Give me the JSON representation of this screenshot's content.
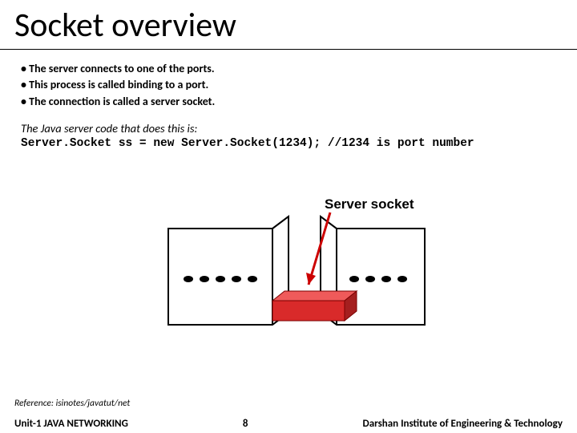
{
  "title": "Socket overview",
  "bullets": [
    {
      "pre": "• The server connects to one of the ports.",
      "bold": "",
      "post": ""
    },
    {
      "pre": "• This process is called ",
      "bold": "binding",
      "post": " to a port."
    },
    {
      "pre": "• The connection is called a server socket.",
      "bold": "",
      "post": ""
    }
  ],
  "intro": "The Java server code that does this is:",
  "code": "Server.Socket ss = new Server.Socket(1234); //1234 is port number",
  "figure_label": "Server socket",
  "reference": "Reference: isinotes/javatut/net",
  "footer": {
    "unit": "Unit-1 JAVA NETWORKING",
    "page": "8",
    "inst": "Darshan Institute of Engineering & Technology"
  }
}
